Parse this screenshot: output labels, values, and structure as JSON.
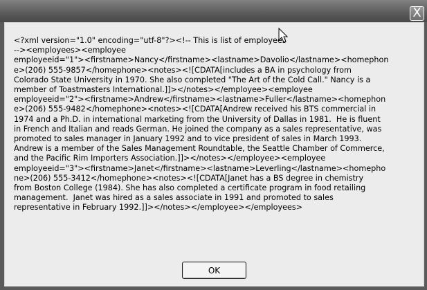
{
  "dialog": {
    "close_label": "X",
    "message_lines": [
      "<?xml version=\"1.0\" encoding=\"utf-8\"?><!-- This is list of employees",
      "--><employees><employee",
      "employeeid=\"1\"><firstname>Nancy</firstname><lastname>Davolio</lastname><homephon",
      "e>(206) 555-9857</homephone><notes><![CDATA[includes a BA in psychology from",
      "Colorado State University in 1970. She also completed \"The Art of the Cold Call.\" Nancy is a",
      "member of Toastmasters International.]]></notes></employee><employee",
      "employeeid=\"2\"><firstname>Andrew</firstname><lastname>Fuller</lastname><homephon",
      "e>(206) 555-9482</homephone><notes><![CDATA[Andrew received his BTS commercial in",
      "1974 and a Ph.D. in international marketing from the University of Dallas in 1981.  He is fluent",
      "in French and Italian and reads German. He joined the company as a sales representative, was",
      "promoted to sales manager in January 1992 and to vice president of sales in March 1993.",
      "Andrew is a member of the Sales Management Roundtable, the Seattle Chamber of Commerce,",
      "and the Pacific Rim Importers Association.]]></notes></employee><employee",
      "employeeid=\"3\"><firstname>Janet</firstname><lastname>Leverling</lastname><homepho",
      "ne>(206) 555-3412</homephone><notes><![CDATA[Janet has a BS degree in chemistry",
      "from Boston College (1984). She has also completed a certificate program in food retailing",
      "management.  Janet was hired as a sales associate in 1991 and promoted to sales",
      "representative in February 1992.]]></notes></employee></employees>"
    ],
    "ok_label": "OK"
  },
  "icons": {
    "close": "close-icon",
    "cursor": "mouse-pointer-icon"
  },
  "colors": {
    "titlebar": "#5a5a5a",
    "client": "#ececec",
    "text": "#000000"
  }
}
